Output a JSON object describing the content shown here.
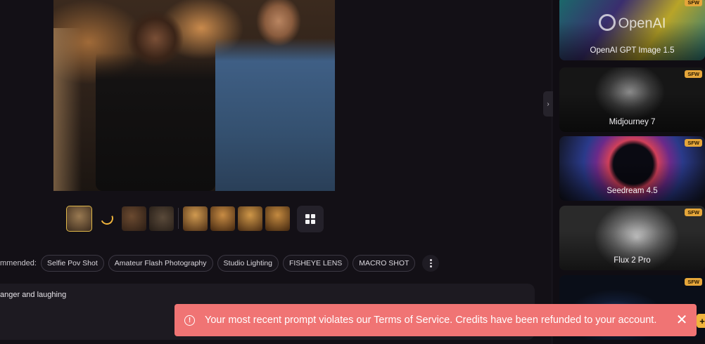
{
  "thumbnails": {
    "items": [
      {
        "name": "thumb-1",
        "selected": true,
        "color": "#6b5236"
      },
      {
        "name": "thumb-loading",
        "loading": true
      },
      {
        "name": "thumb-3",
        "color": "#4a3424"
      },
      {
        "name": "thumb-4",
        "color": "#3d3428"
      },
      {
        "name": "thumb-5",
        "color": "#8a5a2a"
      },
      {
        "name": "thumb-6",
        "color": "#7d5226"
      },
      {
        "name": "thumb-7",
        "color": "#855828"
      },
      {
        "name": "thumb-8",
        "color": "#7a4e24"
      }
    ],
    "grid_icon": "grid-icon"
  },
  "recommended": {
    "label": "mmended:",
    "chips": [
      "Selfie Pov Shot",
      "Amateur Flash Photography",
      "Studio Lighting",
      "FISHEYE LENS",
      "MACRO SHOT"
    ],
    "more_icon": "more-vertical-icon"
  },
  "prompt": {
    "text": "anger and laughing"
  },
  "sidebar": {
    "collapse_icon": "›",
    "models": [
      {
        "name": "OpenAI GPT Image 1.5",
        "badge": "SFW",
        "logo": "OpenAI"
      },
      {
        "name": "Midjourney 7",
        "badge": "SFW"
      },
      {
        "name": "Seedream 4.5",
        "badge": "SFW"
      },
      {
        "name": "Flux 2 Pro",
        "badge": "SFW"
      },
      {
        "name": "",
        "badge": "SFW"
      }
    ]
  },
  "toast": {
    "message": "Your most recent prompt violates our Terms of Service. Credits have been refunded to your account.",
    "icon": "!",
    "close": "✕",
    "color": "#f07474"
  },
  "fab": {
    "label": "+"
  },
  "colors": {
    "accent": "#f0b43c",
    "background": "#131016"
  }
}
